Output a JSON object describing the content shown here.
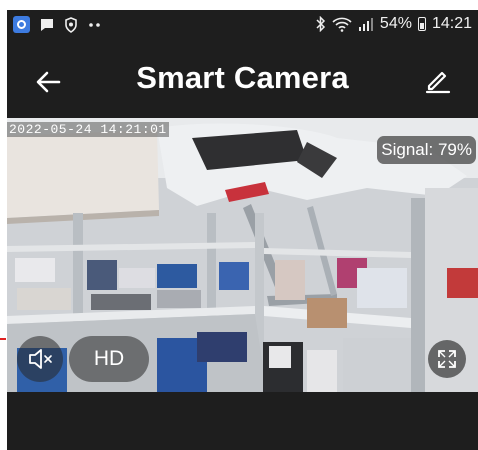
{
  "status_bar": {
    "battery": "54%",
    "time": "14:21",
    "icons": [
      "app-icon",
      "chat-icon",
      "shield-icon",
      "more-icon",
      "bluetooth-icon",
      "wifi-icon",
      "cellular-icon",
      "battery-icon"
    ]
  },
  "app_bar": {
    "title": "Smart Camera",
    "back_icon": "arrow-left-icon",
    "edit_icon": "pencil-icon"
  },
  "camera": {
    "timestamp": "2022-05-24 14:21:01",
    "signal": "Signal: 79%",
    "quality": "HD",
    "mute_icon": "speaker-muted-icon",
    "fullscreen_icon": "fullscreen-icon"
  },
  "colors": {
    "background": "#1e1e1e",
    "text": "#ffffff"
  }
}
